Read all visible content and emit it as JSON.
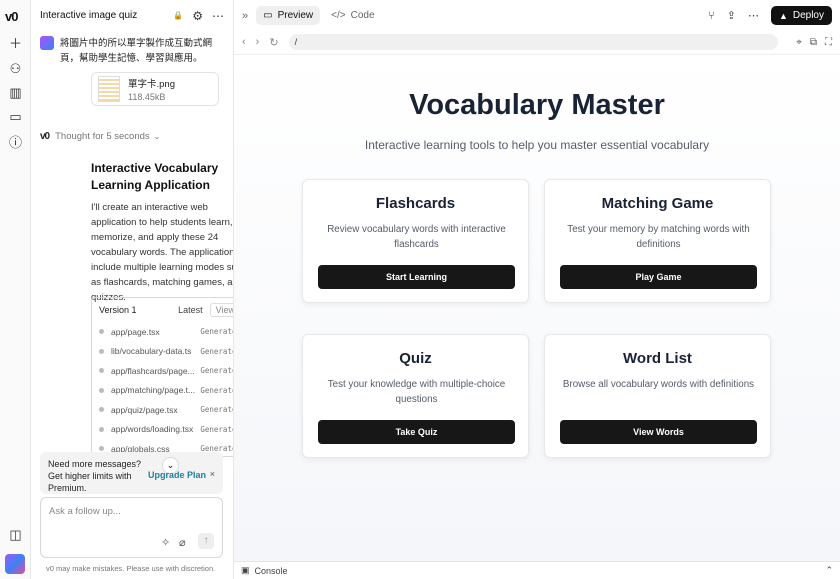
{
  "rail": {
    "logo": "v0",
    "icons": [
      "plus-icon",
      "graph-icon",
      "book-icon",
      "folder-icon",
      "help-icon",
      "sidebar-toggle-icon"
    ]
  },
  "chat": {
    "title": "Interactive image quiz",
    "user_message": "將圖片中的所以單字製作成互動式網頁，幫助學生記憶、學習與應用。",
    "attachment": {
      "name": "單字卡.png",
      "size": "118.45kB"
    },
    "thinking": "Thought for 5 seconds",
    "thinking_logo": "v0",
    "answer_title": "Interactive Vocabulary Learning Application",
    "answer_body": "I'll create an interactive web application to help students learn, memorize, and apply these 24 vocabulary words. The application will include multiple learning modes such as flashcards, matching games, and quizzes.",
    "version": {
      "title": "Version 1",
      "latest": "Latest",
      "view": "View",
      "files": [
        {
          "path": "app/page.tsx",
          "status": "Generated"
        },
        {
          "path": "lib/vocabulary-data.ts",
          "status": "Generated"
        },
        {
          "path": "app/flashcards/page...",
          "status": "Generated"
        },
        {
          "path": "app/matching/page.t...",
          "status": "Generated"
        },
        {
          "path": "app/quiz/page.tsx",
          "status": "Generated"
        },
        {
          "path": "app/words/loading.tsx",
          "status": "Generated"
        },
        {
          "path": "app/globals.css",
          "status": "Generated"
        }
      ]
    },
    "upgrade": {
      "text": "Need more messages? Get higher limits with Premium.",
      "link": "Upgrade Plan",
      "close": "×",
      "chevron": "⌄"
    },
    "followup_placeholder": "Ask a follow up...",
    "disclaimer": "v0 may make mistakes. Please use with discretion."
  },
  "topbar": {
    "collapse": "»",
    "tabs": [
      {
        "label": "Preview",
        "icon": "preview-icon",
        "glyph": "▭",
        "active": true
      },
      {
        "label": "Code",
        "icon": "code-icon",
        "glyph": "</>",
        "active": false
      }
    ],
    "deploy": "Deploy"
  },
  "urlbar": {
    "path": "/"
  },
  "app": {
    "title": "Vocabulary Master",
    "subtitle": "Interactive learning tools to help you master essential vocabulary",
    "cards": [
      {
        "title": "Flashcards",
        "desc": "Review vocabulary words with interactive flashcards",
        "button": "Start Learning"
      },
      {
        "title": "Matching Game",
        "desc": "Test your memory by matching words with definitions",
        "button": "Play Game"
      },
      {
        "title": "Quiz",
        "desc": "Test your knowledge with multiple-choice questions",
        "button": "Take Quiz"
      },
      {
        "title": "Word List",
        "desc": "Browse all vocabulary words with definitions",
        "button": "View Words"
      }
    ]
  },
  "console": {
    "label": "Console"
  },
  "colors": {
    "button": "#171717",
    "link": "#1d7fa0",
    "title": "#1a2236"
  }
}
